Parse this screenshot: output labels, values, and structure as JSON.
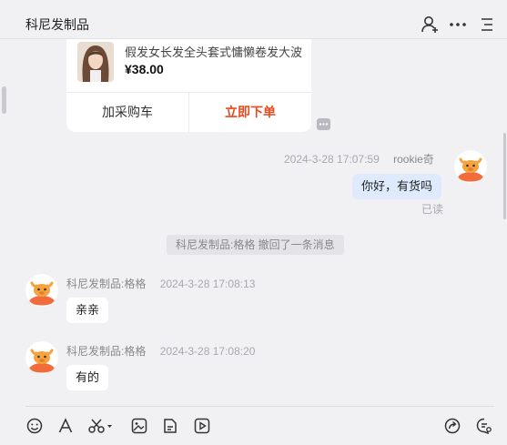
{
  "header": {
    "title": "科尼发制品",
    "icons": [
      "add-user-icon",
      "more-icon",
      "menu-icon"
    ]
  },
  "product_card": {
    "title": "假发女长发全头套式慵懒卷发大波",
    "price": "¥38.00",
    "add_to_cart_label": "加采购车",
    "buy_now_label": "立即下单"
  },
  "messages": [
    {
      "side": "right",
      "sender": "rookie奇",
      "time": "2024-3-28 17:07:59",
      "text": "你好，有货吗",
      "status": "已读"
    },
    {
      "side": "center",
      "notice": "科尼发制品:格格 撤回了一条消息"
    },
    {
      "side": "left",
      "sender": "科尼发制品:格格",
      "time": "2024-3-28 17:08:13",
      "text": "亲亲"
    },
    {
      "side": "left",
      "sender": "科尼发制品:格格",
      "time": "2024-3-28 17:08:20",
      "text": "有的"
    }
  ],
  "toolbar": {
    "icons": [
      "emoji-icon",
      "font-icon",
      "scissors-icon",
      "image-icon",
      "file-icon",
      "video-icon",
      "share-icon",
      "chat-settings-icon"
    ]
  },
  "colors": {
    "accent": "#e8491f",
    "my_bubble": "#dfeaff",
    "avatar_orange": "#f26b3a"
  }
}
